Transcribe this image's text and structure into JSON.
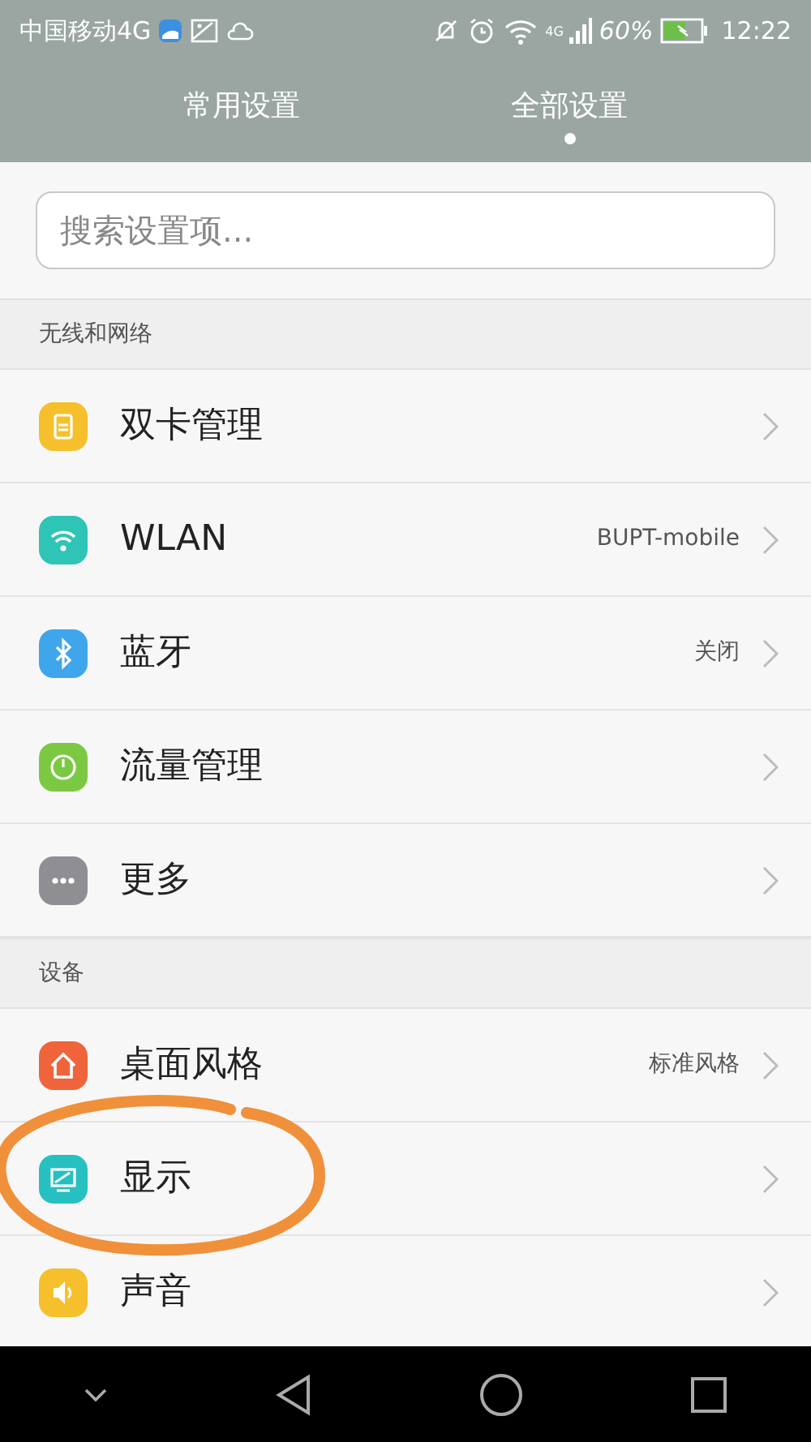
{
  "status_bar": {
    "carrier": "中国移动4G",
    "network": "4G",
    "battery": "60%",
    "time": "12:22"
  },
  "tabs": [
    {
      "label": "常用设置",
      "selected": false
    },
    {
      "label": "全部设置",
      "selected": true
    }
  ],
  "search": {
    "placeholder": "搜索设置项..."
  },
  "sections": [
    {
      "title": "无线和网络",
      "items": [
        {
          "label": "双卡管理",
          "kind": "sim",
          "color": "#f6c02c",
          "circled": false
        },
        {
          "label": "WLAN",
          "value": "BUPT-mobile",
          "kind": "wifi",
          "color": "#2ec4b6",
          "circled": false
        },
        {
          "label": "蓝牙",
          "value": "关闭",
          "kind": "bluetooth",
          "color": "#3fa6ec",
          "circled": false
        },
        {
          "label": "流量管理",
          "kind": "gauge",
          "color": "#7bc943",
          "circled": false
        },
        {
          "label": "更多",
          "kind": "more",
          "color": "#8e8e93",
          "circled": false
        }
      ]
    },
    {
      "title": "设备",
      "items": [
        {
          "label": "桌面风格",
          "value": "标准风格",
          "kind": "home",
          "color": "#f0643c",
          "circled": false
        },
        {
          "label": "显示",
          "kind": "display",
          "color": "#26c0c0",
          "circled": true
        },
        {
          "label": "声音",
          "kind": "sound",
          "color": "#f6c02c",
          "circled": false
        }
      ]
    }
  ]
}
